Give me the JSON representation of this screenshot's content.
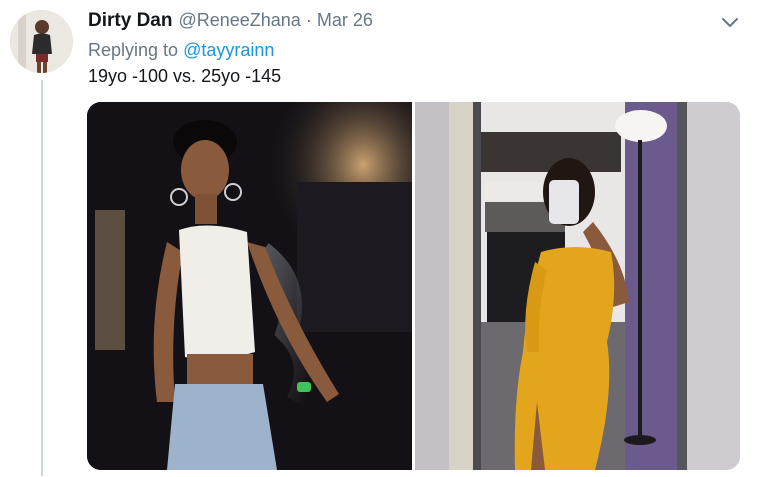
{
  "tweet": {
    "display_name": "Dirty Dan",
    "handle": "@ReneeZhana",
    "separator": "·",
    "date": "Mar 26",
    "replying_prefix": "Replying to",
    "replying_to": "@tayyrainn",
    "text": "19yo -100  vs. 25yo -145"
  },
  "icons": {
    "menu": "chevron-down-icon"
  },
  "colors": {
    "secondary_text": "#657786",
    "link": "#1b95e0",
    "thread_line": "#ccd6dd"
  }
}
